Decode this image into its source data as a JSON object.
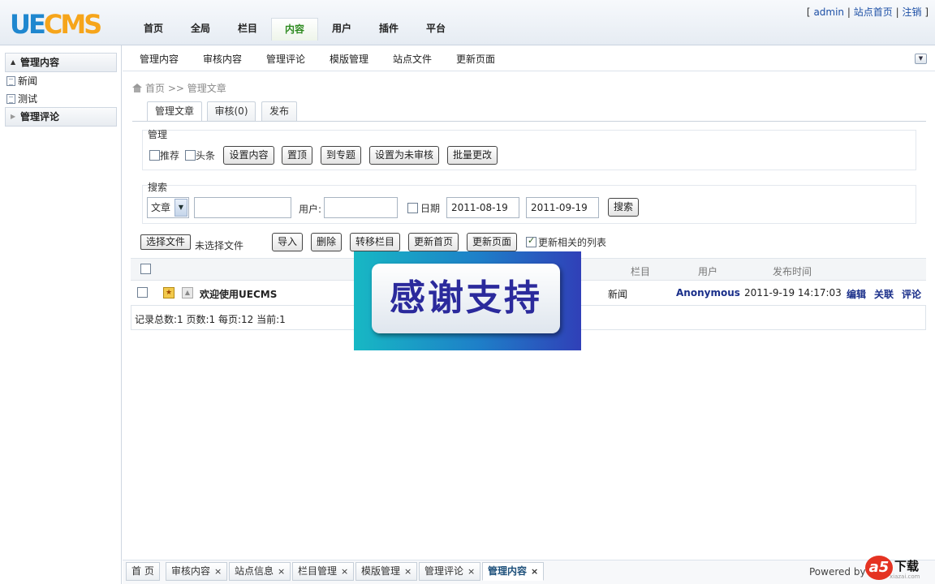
{
  "app": {
    "logo_ue": "UE",
    "logo_cms": "CMS"
  },
  "topnav": [
    "首页",
    "全局",
    "栏目",
    "内容",
    "用户",
    "插件",
    "平台"
  ],
  "topnav_active": "内容",
  "userbar": {
    "lb": "[",
    "user": "admin",
    "sep": "|",
    "home": "站点首页",
    "logout": "注销",
    "rb": "]"
  },
  "sidebar": {
    "group1": "管理内容",
    "items": [
      "新闻",
      "测试"
    ],
    "group2": "管理评论"
  },
  "subnav": [
    "管理内容",
    "审核内容",
    "管理评论",
    "模版管理",
    "站点文件",
    "更新页面"
  ],
  "breadcrumb": {
    "home": "首页",
    "sep": ">>",
    "current": "管理文章"
  },
  "tabs": [
    "管理文章",
    "审核(0)",
    "发布"
  ],
  "manage": {
    "title": "管理",
    "recommend": "推荐",
    "headline": "头条",
    "buttons": [
      "设置内容",
      "置顶",
      "到专题",
      "设置为未审核",
      "批量更改"
    ]
  },
  "search": {
    "title": "搜索",
    "type_value": "文章",
    "keyword_value": "",
    "user_label": "用户:",
    "user_value": "",
    "date_label": "日期",
    "date_from": "2011-08-19",
    "date_to": "2011-09-19",
    "button": "搜索"
  },
  "toolbar": {
    "choose_file": "选择文件",
    "no_file": "未选择文件",
    "buttons": [
      "导入",
      "删除",
      "转移栏目",
      "更新首页",
      "更新页面"
    ],
    "update_related": "更新相关的列表",
    "update_related_checked": true
  },
  "table": {
    "headers": {
      "column": "栏目",
      "user": "用户",
      "time": "发布时间"
    },
    "rows": [
      {
        "title": "欢迎使用UECMS",
        "column": "新闻",
        "user": "Anonymous",
        "time": "2011-9-19 14:17:03",
        "actions": [
          "编辑",
          "关联",
          "评论"
        ]
      }
    ],
    "footer": "记录总数:1 页数:1 每页:12 当前:1"
  },
  "overlay": {
    "text": "感谢支持"
  },
  "bottom_tabs": [
    {
      "label": "首 页",
      "closable": false
    },
    {
      "label": "审核内容",
      "closable": true
    },
    {
      "label": "站点信息",
      "closable": true
    },
    {
      "label": "栏目管理",
      "closable": true
    },
    {
      "label": "模版管理",
      "closable": true
    },
    {
      "label": "管理评论",
      "closable": true
    },
    {
      "label": "管理内容",
      "closable": true,
      "active": true
    }
  ],
  "close_glyph": "×",
  "powered": "Powered by",
  "watermark": {
    "a5": "a5",
    "download": "下载",
    "site": "xiazai.com"
  },
  "colors": {
    "accent_green": "#2d8a1f",
    "link_blue": "#1c4fa5",
    "action_navy": "#1a2f8a",
    "logo_blue": "#1f87cf",
    "logo_orange": "#f6a51b"
  }
}
